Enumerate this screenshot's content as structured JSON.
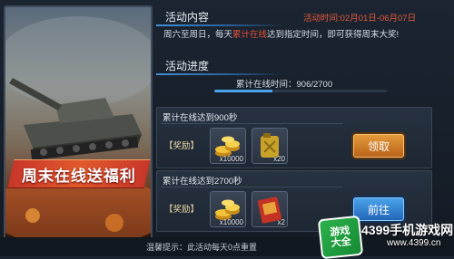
{
  "banner": {
    "title": "周末在线送福利"
  },
  "activity": {
    "content_heading": "活动内容",
    "time": "活动时间:02月01日-06月07日",
    "desc_prefix": "周六至周日，每天",
    "desc_highlight": "累计在线",
    "desc_suffix": "达到指定时间，即可获得周末大奖!",
    "progress_heading": "活动进度",
    "progress_label": "累计在线时间：906/2700",
    "progress_fraction": 0.3356
  },
  "tasks": [
    {
      "title": "累计在线达到900秒",
      "reward_label": "【奖励】",
      "rewards": [
        {
          "icon": "gold-coins-icon",
          "qty": "x10000"
        },
        {
          "icon": "fuel-canister-icon",
          "qty": "x20"
        }
      ],
      "button": "领取",
      "button_kind": "claim"
    },
    {
      "title": "累计在线达到2700秒",
      "reward_label": "【奖励】",
      "rewards": [
        {
          "icon": "gold-coins-icon",
          "qty": "x10000"
        },
        {
          "icon": "red-card-icon",
          "qty": "x2"
        }
      ],
      "button": "前往",
      "button_kind": "go"
    }
  ],
  "hint": "温馨提示：此活动每天0点重置",
  "watermark": {
    "badge_line1": "游戏",
    "badge_line2": "大全",
    "site_name": "4399手机游戏网",
    "site_url": "www.4399.cn"
  },
  "colors": {
    "accent_blue": "#4aa3e8",
    "highlight_red": "#e5503a",
    "claim_orange": "#d47e2a",
    "go_blue": "#3a86d6"
  }
}
